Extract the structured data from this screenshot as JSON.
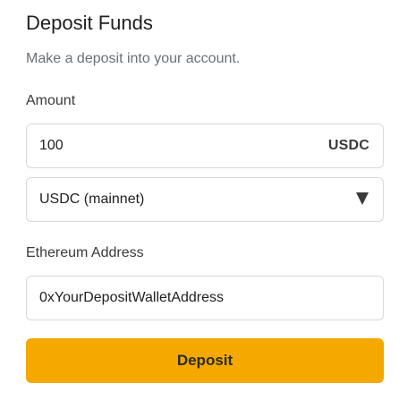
{
  "form": {
    "title": "Deposit Funds",
    "subtitle": "Make a deposit into your account.",
    "amount": {
      "label": "Amount",
      "value": "100",
      "currency": "USDC"
    },
    "network": {
      "selected": "USDC (mainnet)",
      "icon": "chevron-down-triangle-icon"
    },
    "address": {
      "label": "Ethereum Address",
      "value": "0xYourDepositWalletAddress"
    },
    "submit_label": "Deposit"
  },
  "colors": {
    "accent": "#f5a800",
    "border": "#d9d9dc",
    "muted_text": "#6b6f76",
    "text": "#1f1f1f"
  }
}
